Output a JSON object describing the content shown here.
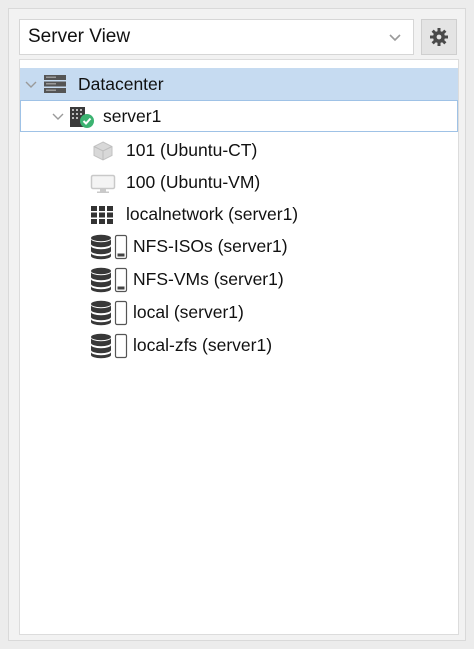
{
  "header": {
    "view_select_value": "Server View",
    "icons": [
      "chevron-down-icon",
      "gear-icon"
    ]
  },
  "tree": {
    "datacenter": {
      "label": "Datacenter",
      "icon": "datacenter-icon"
    },
    "node": {
      "label": "server1",
      "icon": "server-online-icon",
      "status_color": "#3cb371"
    },
    "children": [
      {
        "label": "101 (Ubuntu-CT)",
        "icon": "container-icon"
      },
      {
        "label": "100 (Ubuntu-VM)",
        "icon": "monitor-icon"
      },
      {
        "label": "localnetwork (server1)",
        "icon": "network-grid-icon"
      },
      {
        "label": "NFS-ISOs (server1)",
        "icon": "storage-icon"
      },
      {
        "label": "NFS-VMs (server1)",
        "icon": "storage-icon"
      },
      {
        "label": "local (server1)",
        "icon": "storage-icon"
      },
      {
        "label": "local-zfs (server1)",
        "icon": "storage-icon"
      }
    ]
  },
  "colors": {
    "selected_row": "#c6dbf1",
    "focus_border": "#9fc2e6",
    "icon_dark": "#3b3b3b",
    "icon_light": "#c9c9c9"
  }
}
